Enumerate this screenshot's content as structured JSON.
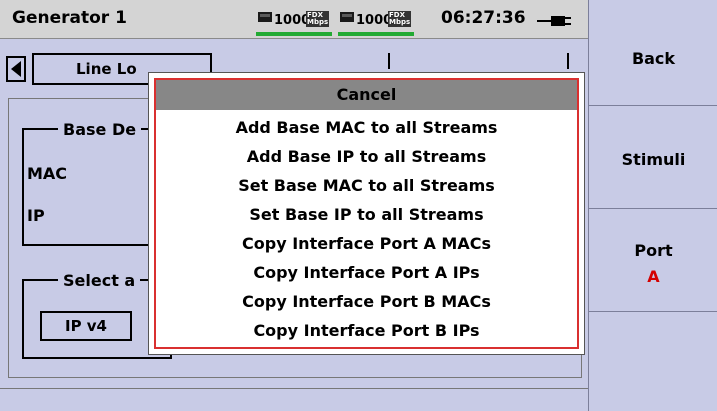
{
  "window": {
    "title": "Generator 1"
  },
  "status": {
    "link1_speed": "1000",
    "link1_duplex": "FDX",
    "link1_unit": "Mbps",
    "link2_speed": "1000",
    "link2_duplex": "FDX",
    "link2_unit": "Mbps",
    "clock": "06:27:36",
    "accent_green": "#22aa33"
  },
  "softkeys": {
    "back_label": "Back",
    "stimuli_label": "Stimuli",
    "port_label": "Port",
    "port_value": "A",
    "port_value_color": "#d40000"
  },
  "tabs": [
    {
      "label": "Line Lo"
    },
    {
      "label": ""
    },
    {
      "label": ""
    }
  ],
  "background": {
    "group1_label": "Base De",
    "mac_label": "MAC",
    "ip_label": "IP",
    "group2_label": "Select a",
    "ipv4_button": "IP v4"
  },
  "menu": {
    "cancel_label": "Cancel",
    "items": [
      "Add Base MAC to all Streams",
      "Add Base IP to all Streams",
      "Set Base MAC to all Streams",
      "Set Base IP to all Streams",
      "Copy Interface Port A MACs",
      "Copy Interface Port A IPs",
      "Copy Interface Port B MACs",
      "Copy Interface Port B IPs"
    ],
    "border_color": "#d93030"
  }
}
